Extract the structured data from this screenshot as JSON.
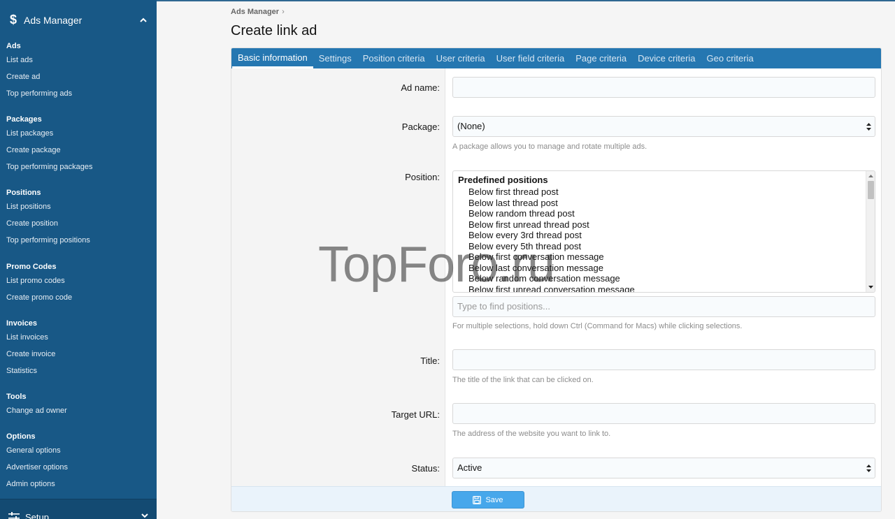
{
  "sidebar": {
    "header": {
      "icon": "dollar-icon",
      "label": "Ads Manager"
    },
    "groups": [
      {
        "title": "Ads",
        "items": [
          "List ads",
          "Create ad",
          "Top performing ads"
        ]
      },
      {
        "title": "Packages",
        "items": [
          "List packages",
          "Create package",
          "Top performing packages"
        ]
      },
      {
        "title": "Positions",
        "items": [
          "List positions",
          "Create position",
          "Top performing positions"
        ]
      },
      {
        "title": "Promo Codes",
        "items": [
          "List promo codes",
          "Create promo code"
        ]
      },
      {
        "title": "Invoices",
        "items": [
          "List invoices",
          "Create invoice",
          "Statistics"
        ]
      },
      {
        "title": "Tools",
        "items": [
          "Change ad owner"
        ]
      },
      {
        "title": "Options",
        "items": [
          "General options",
          "Advertiser options",
          "Admin options"
        ]
      }
    ],
    "footer": {
      "label": "Setup"
    }
  },
  "breadcrumb": {
    "item": "Ads Manager",
    "sep": "›"
  },
  "page_title": "Create link ad",
  "tabs": [
    "Basic information",
    "Settings",
    "Position criteria",
    "User criteria",
    "User field criteria",
    "Page criteria",
    "Device criteria",
    "Geo criteria"
  ],
  "form": {
    "ad_name": {
      "label": "Ad name:",
      "value": ""
    },
    "package": {
      "label": "Package:",
      "value": "(None)",
      "hint": "A package allows you to manage and rotate multiple ads."
    },
    "position": {
      "label": "Position:",
      "group": "Predefined positions",
      "options": [
        "Below first thread post",
        "Below last thread post",
        "Below random thread post",
        "Below first unread thread post",
        "Below every 3rd thread post",
        "Below every 5th thread post",
        "Below first conversation message",
        "Below last conversation message",
        "Below random conversation message",
        "Below first unread conversation message"
      ],
      "filter_placeholder": "Type to find positions...",
      "hint": "For multiple selections, hold down Ctrl (Command for Macs) while clicking selections."
    },
    "title": {
      "label": "Title:",
      "value": "",
      "hint": "The title of the link that can be clicked on."
    },
    "target_url": {
      "label": "Target URL:",
      "value": "",
      "hint": "The address of the website you want to link to."
    },
    "status": {
      "label": "Status:",
      "value": "Active"
    }
  },
  "save_button": {
    "label": "Save",
    "icon": "save-icon"
  },
  "watermark": "TopForo.ru",
  "colors": {
    "sidebar": "#185886",
    "tabs": "#2577b1",
    "button": "#47a7eb"
  }
}
